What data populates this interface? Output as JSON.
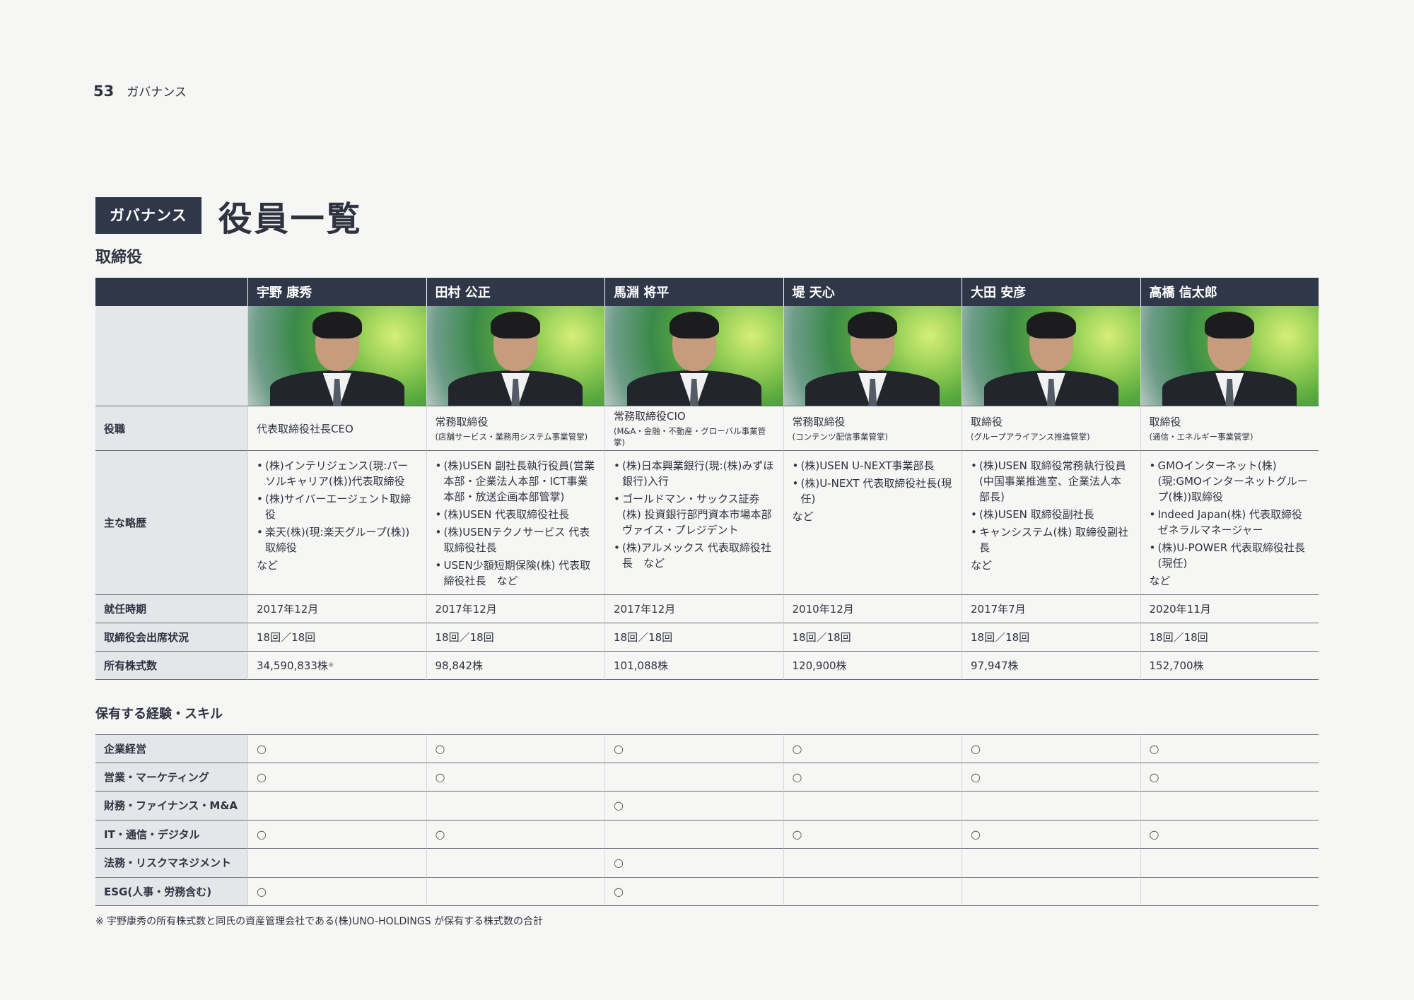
{
  "page": {
    "number": "53",
    "section": "ガバナンス"
  },
  "title": {
    "badge": "ガバナンス",
    "main": "役員一覧",
    "sub": "取締役"
  },
  "directors": [
    {
      "name": "宇野 康秀",
      "photo_icon": "director-photo",
      "role": "代表取締役社長CEO",
      "role_sub": "",
      "career": [
        "(株)インテリジェンス(現:パーソルキャリア(株))代表取締役",
        "(株)サイバーエージェント取締役",
        "楽天(株)(現:楽天グループ(株))取締役"
      ],
      "career_after": "など",
      "tenure": "2017年12月",
      "attendance": "18回／18回",
      "shares": "34,590,833株",
      "shares_note": "※"
    },
    {
      "name": "田村 公正",
      "photo_icon": "director-photo",
      "role": "常務取締役",
      "role_sub": "(店舗サービス・業務用システム事業管掌)",
      "career": [
        "(株)USEN 副社長執行役員(営業本部・企業法人本部・ICT事業本部・放送企画本部管掌)",
        "(株)USEN 代表取締役社長",
        "(株)USENテクノサービス 代表取締役社長",
        "USEN少額短期保険(株) 代表取締役社長　など"
      ],
      "career_after": "",
      "tenure": "2017年12月",
      "attendance": "18回／18回",
      "shares": "98,842株",
      "shares_note": ""
    },
    {
      "name": "馬淵 将平",
      "photo_icon": "director-photo",
      "role": "常務取締役CIO",
      "role_sub": "(M&A・金融・不動産・グローバル事業管掌)",
      "career": [
        "(株)日本興業銀行(現:(株)みずほ銀行)入行",
        "ゴールドマン・サックス証券(株) 投資銀行部門資本市場本部 ヴァイス・プレジデント",
        "(株)アルメックス 代表取締役社長　など"
      ],
      "career_after": "",
      "tenure": "2017年12月",
      "attendance": "18回／18回",
      "shares": "101,088株",
      "shares_note": ""
    },
    {
      "name": "堤 天心",
      "photo_icon": "director-photo",
      "role": "常務取締役",
      "role_sub": "(コンテンツ配信事業管掌)",
      "career": [
        "(株)USEN U-NEXT事業部長",
        "(株)U-NEXT 代表取締役社長(現任)"
      ],
      "career_after": "など",
      "tenure": "2010年12月",
      "attendance": "18回／18回",
      "shares": "120,900株",
      "shares_note": ""
    },
    {
      "name": "大田 安彦",
      "photo_icon": "director-photo",
      "role": "取締役",
      "role_sub": "(グループアライアンス推進管掌)",
      "career": [
        "(株)USEN 取締役常務執行役員(中国事業推進室、企業法人本部長)",
        "(株)USEN 取締役副社長",
        "キャンシステム(株) 取締役副社長"
      ],
      "career_after": "など",
      "tenure": "2017年7月",
      "attendance": "18回／18回",
      "shares": "97,947株",
      "shares_note": ""
    },
    {
      "name": "高橋 信太郎",
      "photo_icon": "director-photo",
      "role": "取締役",
      "role_sub": "(通信・エネルギー事業管掌)",
      "career": [
        "GMOインターネット(株)(現:GMOインターネットグループ(株))取締役",
        "Indeed Japan(株) 代表取締役 ゼネラルマネージャー",
        "(株)U-POWER 代表取締役社長(現任)"
      ],
      "career_after": "など",
      "tenure": "2020年11月",
      "attendance": "18回／18回",
      "shares": "152,700株",
      "shares_note": ""
    }
  ],
  "row_labels": {
    "role": "役職",
    "career": "主な略歴",
    "tenure": "就任時期",
    "attendance": "取締役会出席状況",
    "shares": "所有株式数"
  },
  "skills": {
    "title": "保有する経験・スキル",
    "mark": "○",
    "rows": [
      {
        "label": "企業経営",
        "flags": [
          true,
          true,
          true,
          true,
          true,
          true
        ]
      },
      {
        "label": "営業・マーケティング",
        "flags": [
          true,
          true,
          false,
          true,
          true,
          true
        ]
      },
      {
        "label": "財務・ファイナンス・M&A",
        "flags": [
          false,
          false,
          true,
          false,
          false,
          false
        ]
      },
      {
        "label": "IT・通信・デジタル",
        "flags": [
          true,
          true,
          false,
          true,
          true,
          true
        ]
      },
      {
        "label": "法務・リスクマネジメント",
        "flags": [
          false,
          false,
          true,
          false,
          false,
          false
        ]
      },
      {
        "label": "ESG(人事・労務含む)",
        "flags": [
          true,
          false,
          true,
          false,
          false,
          false
        ]
      }
    ]
  },
  "footnote": "※ 宇野康秀の所有株式数と同氏の資産管理会社である(株)UNO-HOLDINGS が保有する株式数の合計"
}
